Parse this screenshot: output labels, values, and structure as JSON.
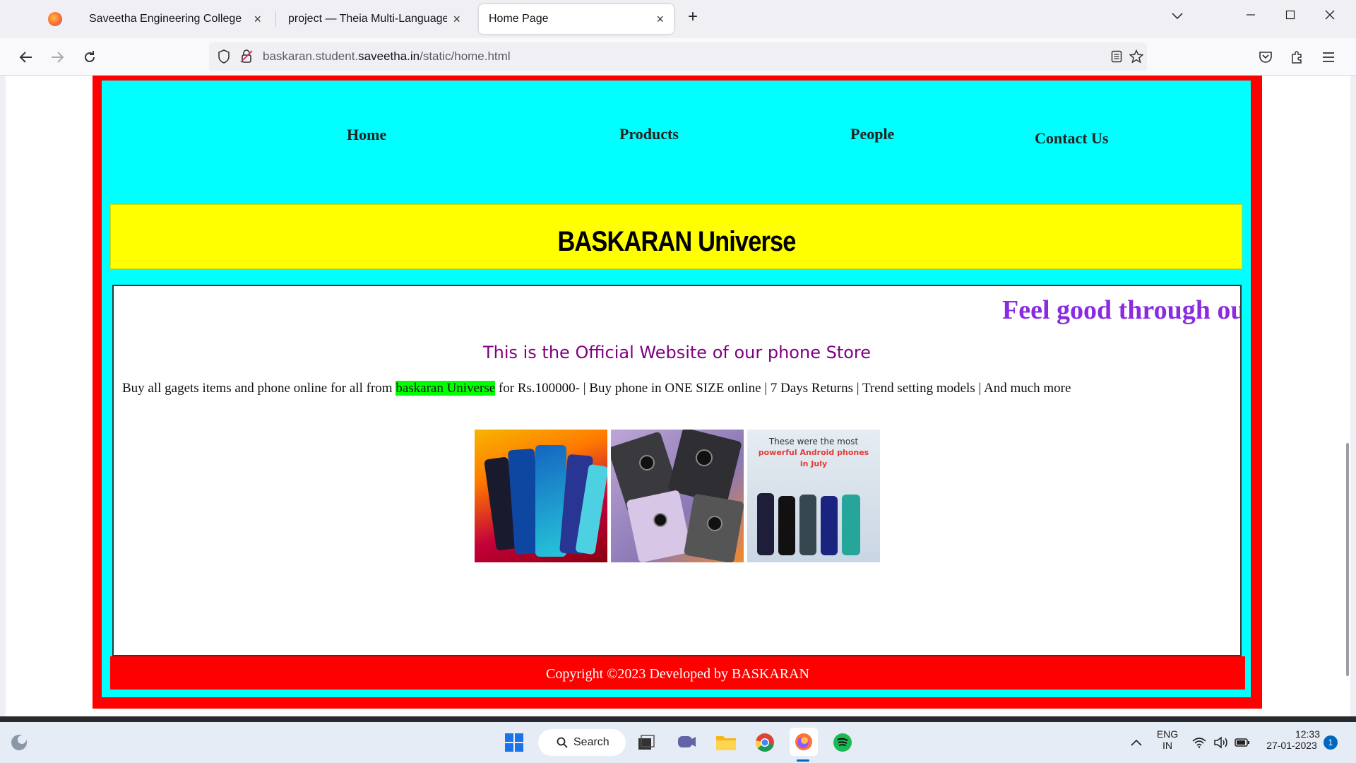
{
  "browser": {
    "tabs": [
      {
        "label": ""
      },
      {
        "label": "Saveetha Engineering College"
      },
      {
        "label": "project — Theia Multi-Language Ex"
      },
      {
        "label": "Home Page"
      }
    ],
    "close_glyph": "×",
    "new_tab_glyph": "+",
    "url_prefix": "baskaran.student.",
    "url_domain": "saveetha.in",
    "url_path": "/static/home.html"
  },
  "page": {
    "menu": {
      "home": "Home",
      "products": "Products",
      "people": "People",
      "contact": "Contact Us"
    },
    "banner_title": "BASKARAN Universe",
    "marquee": "Feel good through our",
    "subtitle": "This is the Official Website of our phone Store",
    "desc_before": "Buy all gagets items and phone online for all from ",
    "desc_highlight": "baskaran Universe",
    "desc_after": " for Rs.100000- | Buy phone in ONE SIZE online | 7 Days Returns | Trend setting models | And much more",
    "photo3_caption_1": "These were the most",
    "photo3_caption_2": "powerful Android phones",
    "photo3_caption_3": "in July",
    "footer": "Copyright ©2023 Developed by BASKARAN"
  },
  "taskbar": {
    "search_label": "Search",
    "lang_1": "ENG",
    "lang_2": "IN",
    "time": "12:33",
    "date": "27-01-2023",
    "notification_count": "1"
  }
}
